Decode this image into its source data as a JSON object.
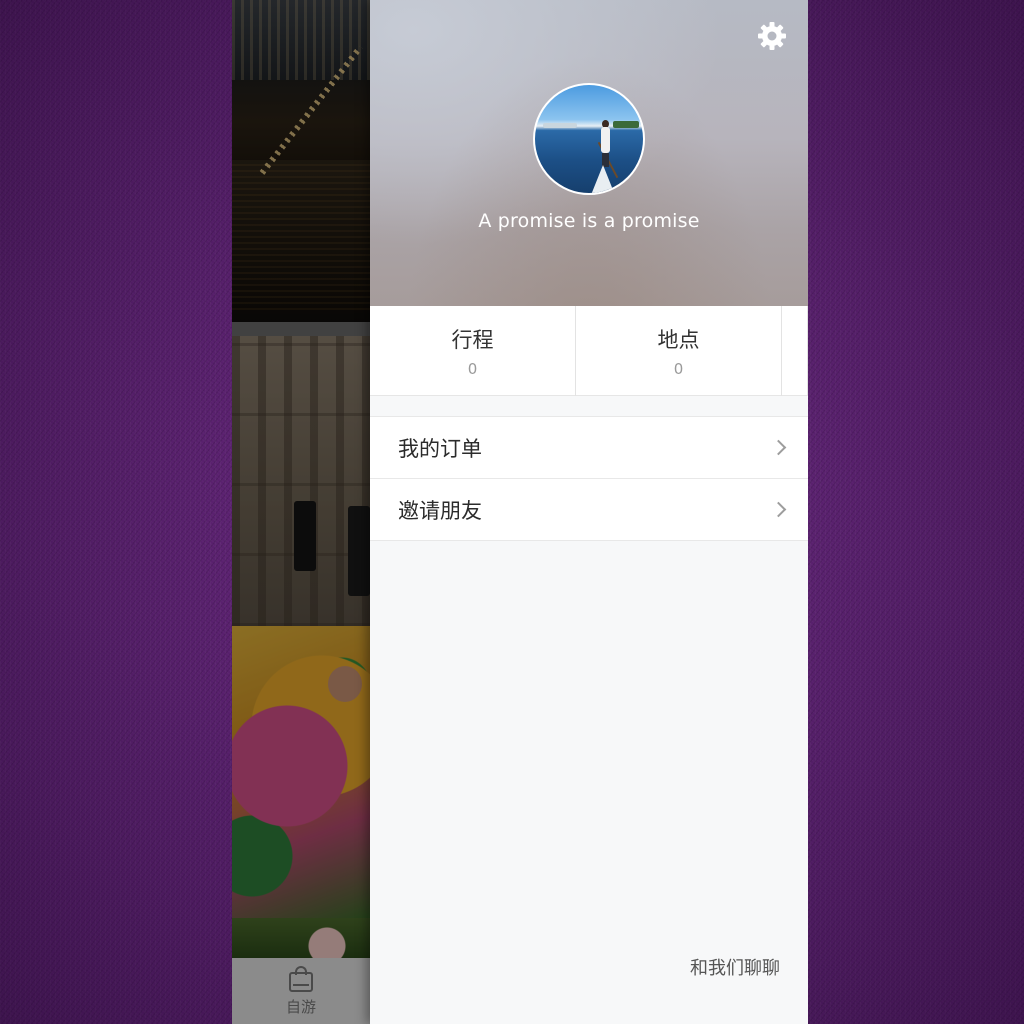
{
  "background_tab": {
    "label": "自游"
  },
  "profile": {
    "tagline": "A promise is a promise"
  },
  "stats": [
    {
      "label": "行程",
      "value": "0"
    },
    {
      "label": "地点",
      "value": "0"
    }
  ],
  "menu": [
    {
      "label": "我的订单"
    },
    {
      "label": "邀请朋友"
    }
  ],
  "footer": {
    "chat_label": "和我们聊聊"
  },
  "colors": {
    "drawer_bg": "#f7f8f9",
    "header_gradient_top": "#b6bac4",
    "header_gradient_bottom": "#a69c9b",
    "page_background": "#6e2a86",
    "text_primary": "#333333",
    "text_muted": "#9a9a9a"
  },
  "icons": {
    "settings": "gear-icon",
    "menu_arrow": "chevron-right-icon",
    "tab": "bag-icon"
  }
}
